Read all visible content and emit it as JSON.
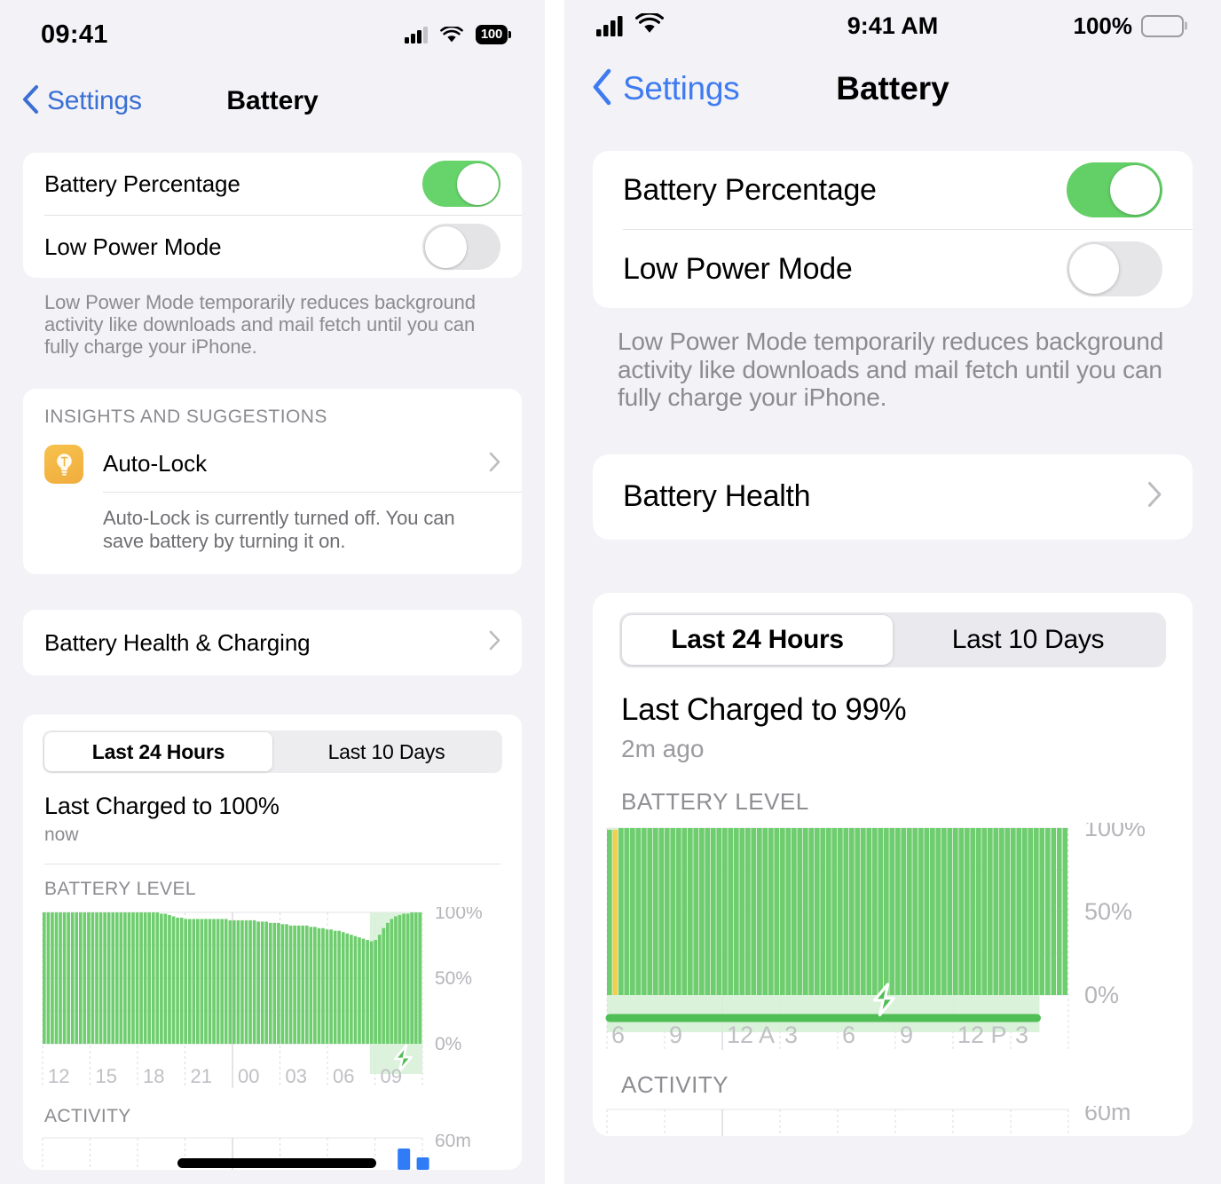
{
  "left": {
    "status_bar": {
      "time": "09:41",
      "cellular_icon": "cellular-bars-icon",
      "wifi_icon": "wifi-icon",
      "battery_percent": "100",
      "battery_icon": "battery-full-icon"
    },
    "nav": {
      "back_label": "Settings",
      "back_icon": "chevron-left-icon",
      "title": "Battery"
    },
    "settings_rows": [
      {
        "label": "Battery Percentage",
        "toggle": "on"
      },
      {
        "label": "Low Power Mode",
        "toggle": "off"
      }
    ],
    "footnote": "Low Power Mode temporarily reduces background activity like downloads and mail fetch until you can fully charge your iPhone.",
    "insights": {
      "header": "INSIGHTS AND SUGGESTIONS",
      "item_label": "Auto-Lock",
      "item_icon": "lightbulb-icon",
      "chevron_icon": "chevron-right-icon",
      "description": "Auto-Lock is currently turned off. You can save battery by turning it on."
    },
    "battery_health_row": {
      "label": "Battery Health & Charging",
      "chevron_icon": "chevron-right-icon"
    },
    "usage": {
      "segments": [
        "Last 24 Hours",
        "Last 10 Days"
      ],
      "selected_segment": 0,
      "charged_title": "Last Charged to 100%",
      "charged_sub": "now",
      "battery_level_header": "BATTERY LEVEL",
      "activity_header": "ACTIVITY",
      "activity_y_label": "60m"
    }
  },
  "right": {
    "status_bar": {
      "cellular_icon": "cellular-bars-icon",
      "wifi_icon": "wifi-icon",
      "time": "9:41 AM",
      "battery_percent": "100%",
      "battery_icon": "battery-full-icon"
    },
    "nav": {
      "back_label": "Settings",
      "back_icon": "chevron-left-icon",
      "title": "Battery"
    },
    "settings_rows": [
      {
        "label": "Battery Percentage",
        "toggle": "on"
      },
      {
        "label": "Low Power Mode",
        "toggle": "off"
      }
    ],
    "footnote": "Low Power Mode temporarily reduces background activity like downloads and mail fetch until you can fully charge your iPhone.",
    "battery_health_row": {
      "label": "Battery Health",
      "chevron_icon": "chevron-right-icon"
    },
    "usage": {
      "segments": [
        "Last 24 Hours",
        "Last 10 Days"
      ],
      "selected_segment": 0,
      "charged_title": "Last Charged to 99%",
      "charged_sub": "2m ago",
      "battery_level_header": "BATTERY LEVEL",
      "activity_header": "ACTIVITY",
      "activity_y_label": "60m"
    }
  },
  "colors": {
    "green_bar": "#6ecd6e",
    "green_bar_light": "#8cd98c",
    "charging_band": "#d6f0d6",
    "yellow_bar": "#f2cf4a",
    "accent_blue": "#3e7bf0",
    "toggle_on": "#66d46a",
    "page_bg": "#f2f2f7",
    "card_bg": "#ffffff",
    "muted_text": "#8b8b90",
    "activity_blue": "#2f7cf6"
  },
  "chart_data": [
    {
      "id": "left-battery-level",
      "type": "bar",
      "title": "BATTERY LEVEL",
      "xlabel": "",
      "ylabel": "",
      "ylim": [
        0,
        100
      ],
      "ytick_labels": [
        "100%",
        "50%",
        "0%"
      ],
      "ytick_values": [
        100,
        50,
        0
      ],
      "xtick_labels": [
        "12",
        "15",
        "18",
        "21",
        "00",
        "03",
        "06",
        "09"
      ],
      "grid": true,
      "charging_band": {
        "start_index": 81,
        "end_index": 93
      },
      "values": [
        100,
        100,
        100,
        100,
        100,
        100,
        100,
        100,
        100,
        100,
        100,
        100,
        100,
        100,
        100,
        100,
        100,
        100,
        100,
        100,
        100,
        100,
        100,
        100,
        100,
        100,
        100,
        100,
        100,
        99,
        99,
        98,
        97,
        96,
        96,
        95,
        95,
        95,
        95,
        95,
        95,
        95,
        95,
        95,
        95,
        95,
        94,
        94,
        94,
        94,
        94,
        94,
        94,
        93,
        93,
        93,
        92,
        92,
        92,
        91,
        91,
        90,
        90,
        90,
        90,
        90,
        89,
        89,
        88,
        88,
        87,
        87,
        86,
        86,
        85,
        84,
        83,
        82,
        81,
        80,
        79,
        78,
        79,
        83,
        88,
        92,
        95,
        97,
        98,
        99,
        99,
        100,
        100,
        100
      ]
    },
    {
      "id": "right-battery-level",
      "type": "bar",
      "title": "BATTERY LEVEL",
      "xlabel": "",
      "ylabel": "",
      "ylim": [
        0,
        100
      ],
      "ytick_labels": [
        "100%",
        "50%",
        "0%"
      ],
      "ytick_values": [
        100,
        50,
        0
      ],
      "xtick_labels": [
        "6",
        "9",
        "12 A",
        "3",
        "6",
        "9",
        "12 P",
        "3"
      ],
      "grid": true,
      "charging_band": {
        "start_index": 0,
        "end_index": 74
      },
      "low_power_marker_index": 1,
      "values": [
        99,
        99,
        100,
        100,
        100,
        100,
        100,
        100,
        100,
        100,
        100,
        100,
        100,
        100,
        100,
        100,
        100,
        100,
        100,
        100,
        100,
        100,
        100,
        100,
        100,
        100,
        100,
        100,
        100,
        100,
        100,
        100,
        100,
        100,
        100,
        100,
        100,
        100,
        100,
        100,
        100,
        100,
        100,
        100,
        100,
        100,
        100,
        100,
        100,
        100,
        100,
        100,
        100,
        100,
        100,
        100,
        100,
        100,
        100,
        100,
        100,
        100,
        100,
        100,
        100,
        100,
        100,
        100,
        100,
        100,
        100,
        100,
        100,
        100,
        100,
        100,
        100,
        100,
        100,
        100
      ]
    }
  ]
}
